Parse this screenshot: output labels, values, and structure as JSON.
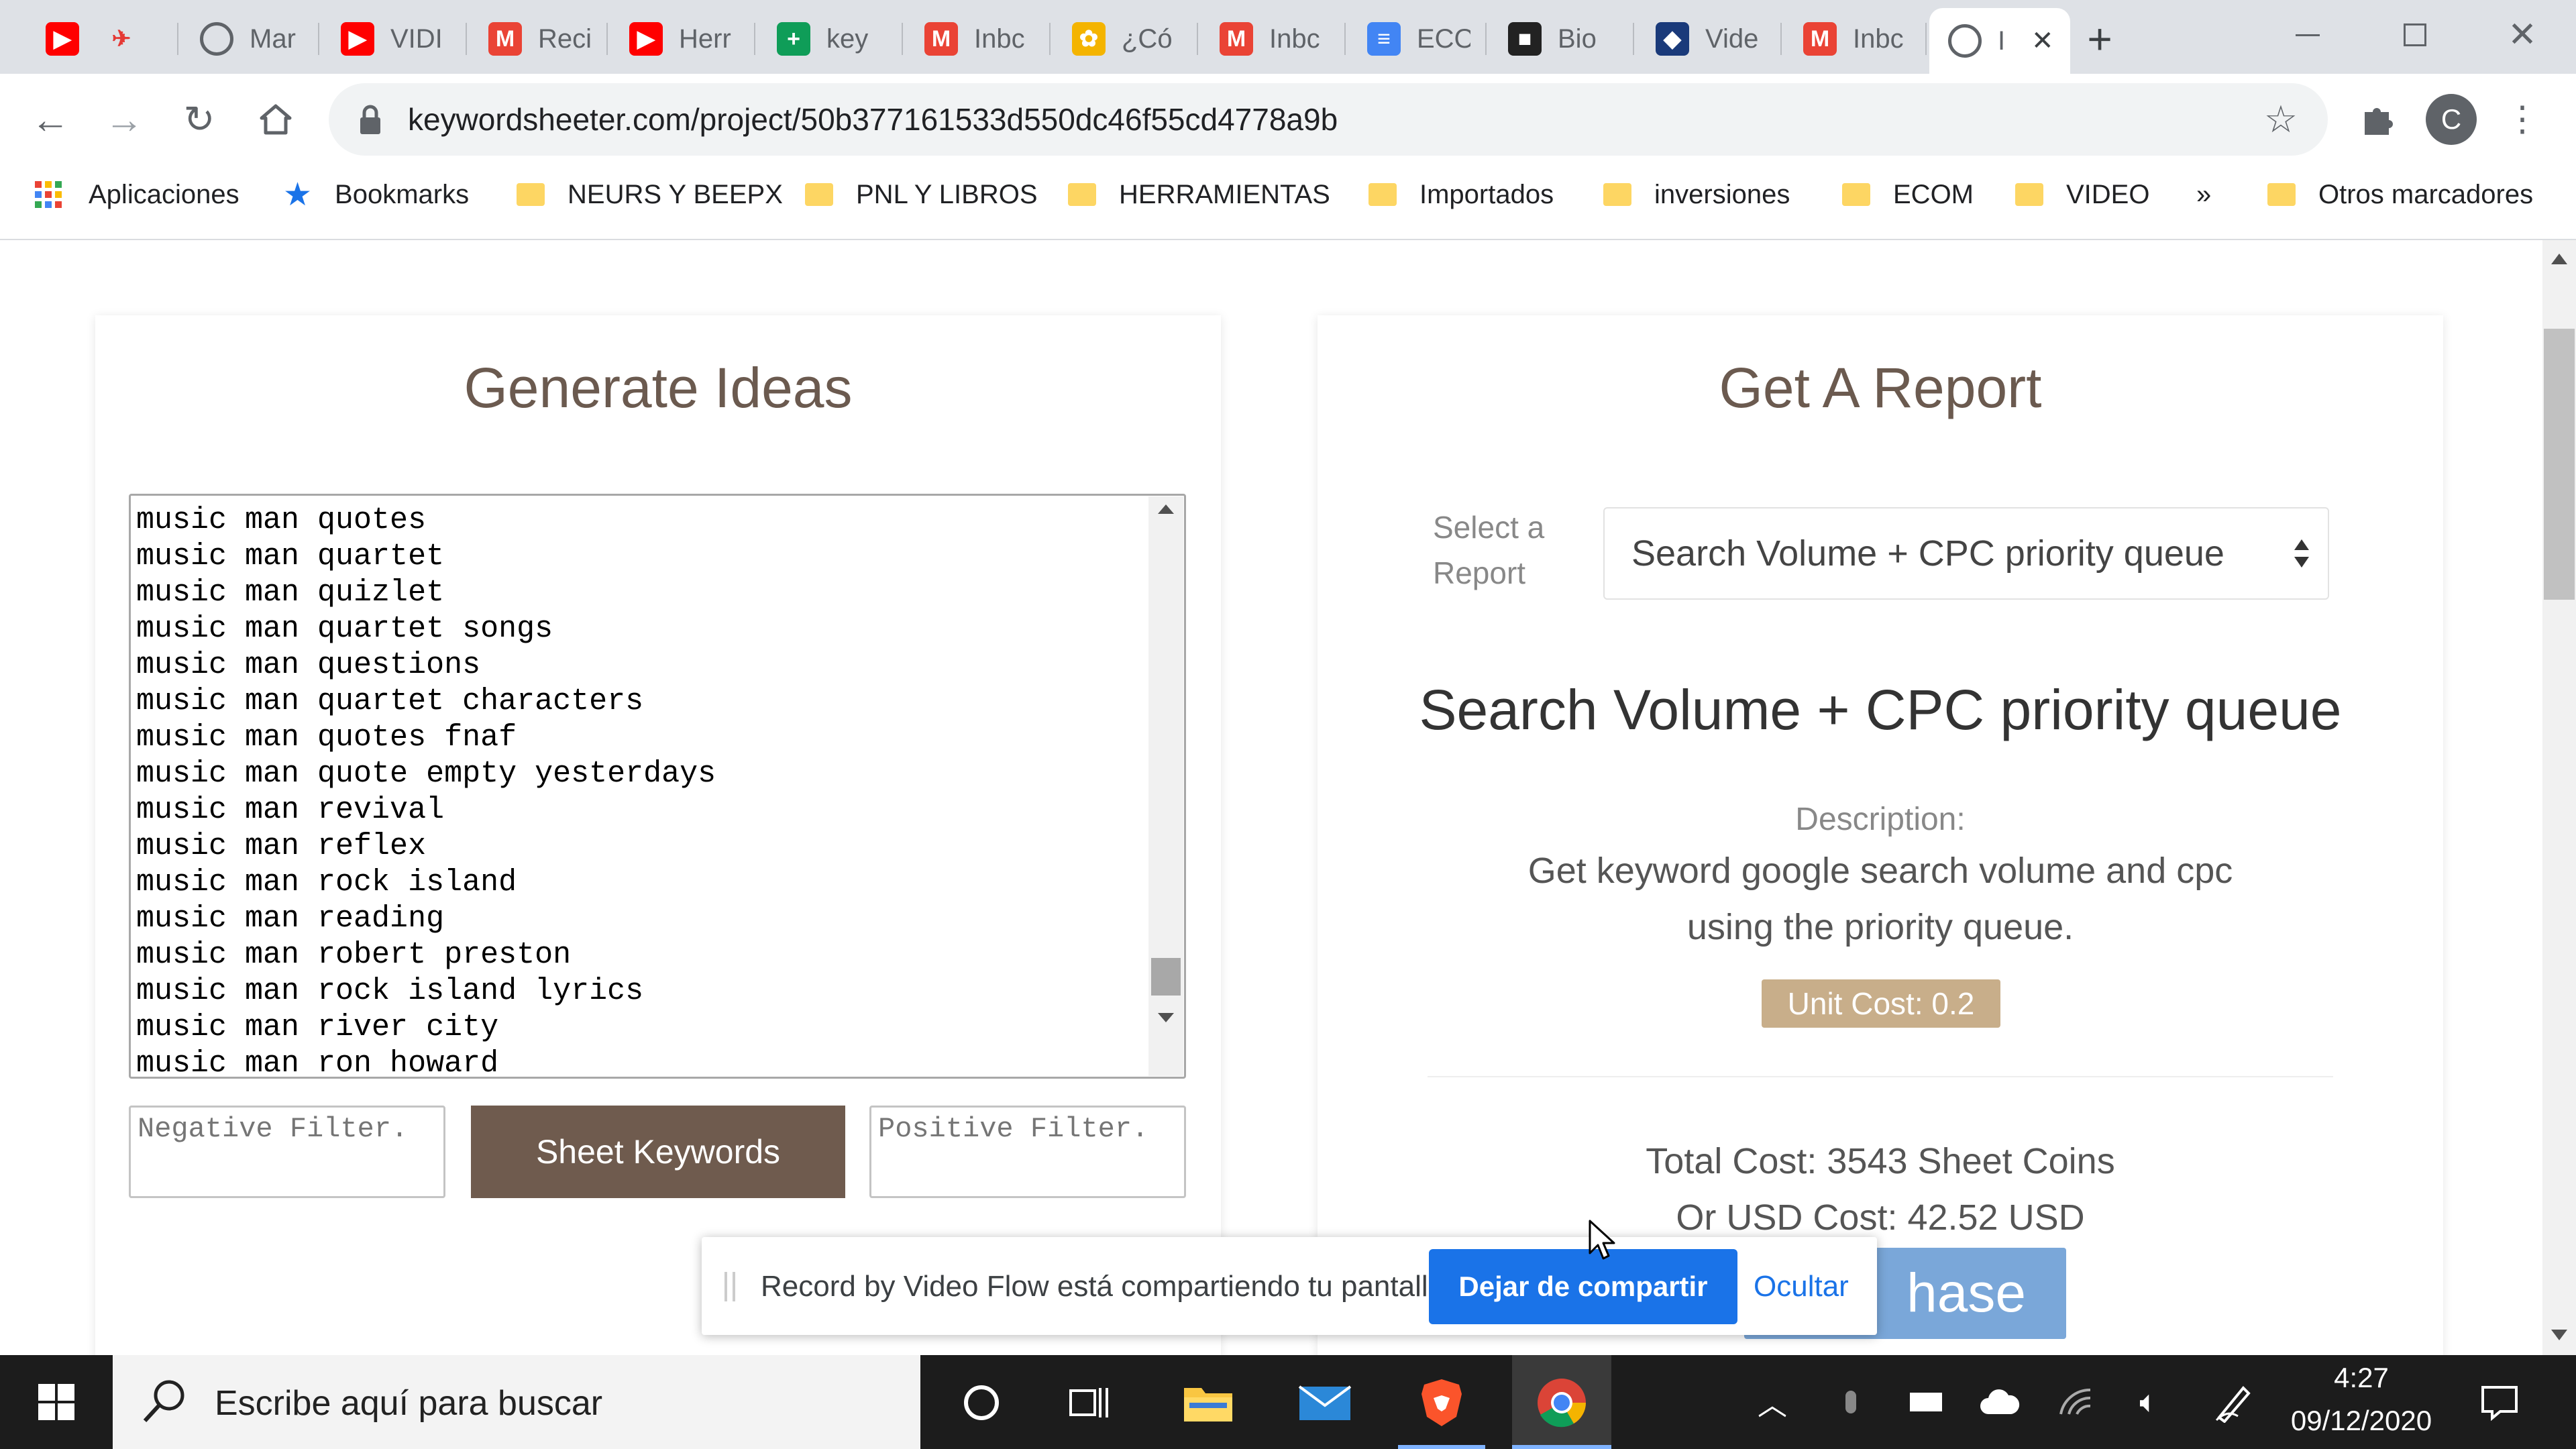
{
  "browser": {
    "tabs": [
      {
        "title": "",
        "icon": "youtube-icon",
        "color": "#ff0000"
      },
      {
        "title": "",
        "icon": "rocket-icon",
        "color": "#ffffff"
      },
      {
        "title": "Mar",
        "icon": "globe-icon",
        "color": "#5f6368"
      },
      {
        "title": "VIDI",
        "icon": "youtube-icon",
        "color": "#ff0000"
      },
      {
        "title": "Reci",
        "icon": "gmail-icon",
        "color": "#ea4335"
      },
      {
        "title": "Herr",
        "icon": "youtube-icon",
        "color": "#ff0000"
      },
      {
        "title": "key",
        "icon": "sheets-icon",
        "color": "#0f9d58"
      },
      {
        "title": "Inbc",
        "icon": "gmail-icon",
        "color": "#ea4335"
      },
      {
        "title": "¿Có",
        "icon": "colorful-icon",
        "color": "#f4b400"
      },
      {
        "title": "Inbc",
        "icon": "gmail-icon",
        "color": "#ea4335"
      },
      {
        "title": "ECO",
        "icon": "docs-icon",
        "color": "#4285f4"
      },
      {
        "title": "Bio",
        "icon": "dark-app-icon",
        "color": "#222222"
      },
      {
        "title": "Vide",
        "icon": "fish-icon",
        "color": "#1a3a7a"
      },
      {
        "title": "Inbc",
        "icon": "gmail-icon",
        "color": "#ea4335"
      },
      {
        "title": "I",
        "icon": "globe-icon",
        "color": "#5f6368"
      }
    ],
    "url": "keywordsheeter.com/project/50b377161533d550dc46f55cd4778a9b",
    "profile_letter": "C",
    "bookmarks": [
      {
        "label": "Aplicaciones",
        "icon": "apps-grid-icon"
      },
      {
        "label": "Bookmarks",
        "icon": "star-icon"
      },
      {
        "label": "NEURS Y BEEPX",
        "icon": "folder-icon"
      },
      {
        "label": "PNL Y LIBROS",
        "icon": "folder-icon"
      },
      {
        "label": "HERRAMIENTAS",
        "icon": "folder-icon"
      },
      {
        "label": "Importados",
        "icon": "folder-icon"
      },
      {
        "label": "inversiones",
        "icon": "folder-icon"
      },
      {
        "label": "ECOM",
        "icon": "folder-icon"
      },
      {
        "label": "VIDEO",
        "icon": "folder-icon"
      }
    ],
    "more_bookmarks": "»",
    "other_bookmarks": "Otros marcadores"
  },
  "generate": {
    "title": "Generate Ideas",
    "keywords": "music man quotes\nmusic man quartet\nmusic man quizlet\nmusic man quartet songs\nmusic man questions\nmusic man quartet characters\nmusic man quotes fnaf\nmusic man quote empty yesterdays\nmusic man revival\nmusic man reflex\nmusic man rock island\nmusic man reading\nmusic man robert preston\nmusic man rock island lyrics\nmusic man river city\nmusic man ron howard",
    "negative_placeholder": "Negative Filter.",
    "positive_placeholder": "Positive Filter.",
    "sheet_button": "Sheet Keywords",
    "button_color": "#6f5b4e"
  },
  "report": {
    "title": "Get A Report",
    "select_label": "Select a Report",
    "selected": "Search Volume + CPC priority queue",
    "heading": "Search Volume + CPC priority queue",
    "description_label": "Description:",
    "description": "Get keyword google search volume and cpc using the priority queue.",
    "unit_cost": "Unit Cost: 0.2",
    "unit_cost_color": "#c8ae8a",
    "total_cost": "Total Cost: 3543 Sheet Coins",
    "usd_cost": "Or USD Cost: 42.52 USD",
    "purchase_partial": "hase",
    "purchase_color": "#7aa7d9"
  },
  "share_bar": {
    "message": "Record by Video Flow está compartiendo tu pantalla.",
    "stop_button": "Dejar de compartir",
    "hide_button": "Ocultar",
    "stop_color": "#1a73e8"
  },
  "taskbar": {
    "search_placeholder": "Escribe aquí para buscar",
    "time": "4:27",
    "date": "09/12/2020"
  }
}
